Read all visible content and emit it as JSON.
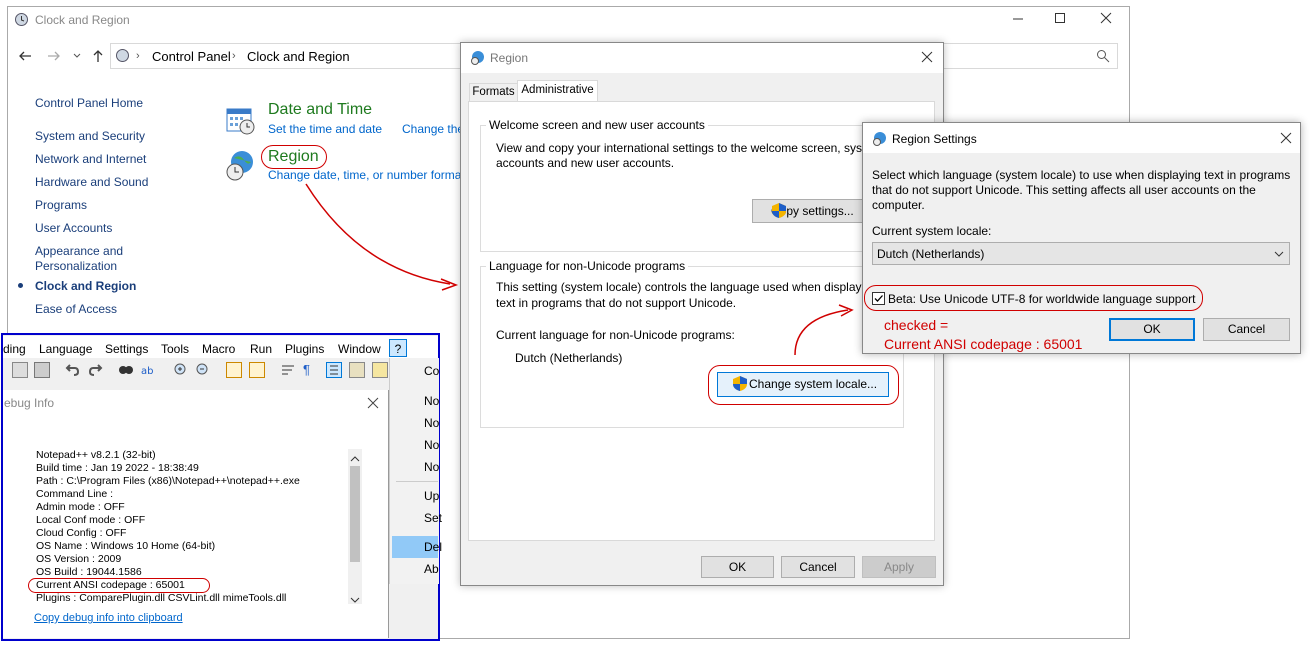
{
  "colors": {
    "accent": "#0078d7",
    "link": "#0066cc",
    "green": "#1e7a1e",
    "annotation": "#d00000",
    "blue_frame": "#0000cc"
  },
  "control_panel": {
    "title": "Clock and Region",
    "breadcrumb": [
      "Control Panel",
      "Clock and Region"
    ],
    "sidebar": {
      "home": "Control Panel Home",
      "items": [
        "System and Security",
        "Network and Internet",
        "Hardware and Sound",
        "Programs",
        "User Accounts",
        "Appearance and Personalization",
        "Clock and Region",
        "Ease of Access"
      ]
    },
    "date_time": {
      "heading": "Date and Time",
      "link1": "Set the time and date",
      "link2": "Change the"
    },
    "region": {
      "heading": "Region",
      "link1": "Change date, time, or number forma"
    }
  },
  "region_dialog": {
    "title": "Region",
    "tabs": [
      "Formats",
      "Administrative"
    ],
    "welcome": {
      "legend": "Welcome screen and new user accounts",
      "text1": "View and copy your international settings to the welcome screen, syst",
      "text2": "accounts and new user accounts.",
      "button": "Copy settings..."
    },
    "nonunicode": {
      "legend": "Language for non-Unicode programs",
      "text1": "This setting (system locale) controls the language used when displayin",
      "text2": "text in programs that do not support Unicode.",
      "current_label": "Current language for non-Unicode programs:",
      "current_value": "Dutch (Netherlands)",
      "button": "Change system locale..."
    },
    "buttons": {
      "ok": "OK",
      "cancel": "Cancel",
      "apply": "Apply"
    }
  },
  "region_settings": {
    "title": "Region Settings",
    "desc1": "Select which language (system locale) to use when displaying text in programs",
    "desc2": "that do not support Unicode. This setting affects all user accounts on the",
    "desc3": "computer.",
    "locale_label": "Current system locale:",
    "locale_value": "Dutch (Netherlands)",
    "beta_label": "Beta: Use Unicode UTF-8 for worldwide language support",
    "beta_checked": true,
    "ok": "OK",
    "cancel": "Cancel"
  },
  "annotation": {
    "line1": "checked =",
    "line2": "Current ANSI codepage : 65001"
  },
  "notepad": {
    "menu": [
      "ding",
      "Language",
      "Settings",
      "Tools",
      "Macro",
      "Run",
      "Plugins",
      "Window",
      "?"
    ],
    "dropdown": [
      "Co",
      "No",
      "No",
      "No",
      "No",
      "Up",
      "Set",
      "Del",
      "Ab"
    ],
    "debug": {
      "title": "ebug Info",
      "lines": [
        "Notepad++ v8.2.1   (32-bit)",
        "Build time : Jan 19 2022 - 18:38:49",
        "Path : C:\\Program Files (x86)\\Notepad++\\notepad++.exe",
        "Command Line :",
        "Admin mode : OFF",
        "Local Conf mode : OFF",
        "Cloud Config : OFF",
        "OS Name : Windows 10 Home (64-bit)",
        "OS Version : 2009",
        "OS Build : 19044.1586",
        "Current ANSI codepage : 65001",
        "Plugins : ComparePlugin.dll CSVLint.dll mimeTools.dll"
      ],
      "copy_link": "Copy debug info into clipboard"
    }
  }
}
